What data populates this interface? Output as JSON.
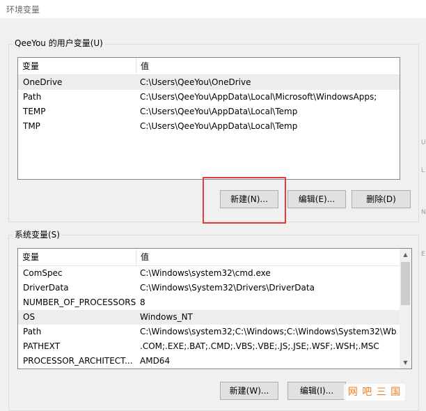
{
  "window": {
    "title": "环境变量"
  },
  "user_vars": {
    "group_label": "QeeYou 的用户变量(U)",
    "columns": [
      "变量",
      "值"
    ],
    "rows": [
      {
        "name": "OneDrive",
        "value": "C:\\Users\\QeeYou\\OneDrive",
        "selected": true
      },
      {
        "name": "Path",
        "value": "C:\\Users\\QeeYou\\AppData\\Local\\Microsoft\\WindowsApps;",
        "selected": false
      },
      {
        "name": "TEMP",
        "value": "C:\\Users\\QeeYou\\AppData\\Local\\Temp",
        "selected": false
      },
      {
        "name": "TMP",
        "value": "C:\\Users\\QeeYou\\AppData\\Local\\Temp",
        "selected": false
      }
    ],
    "buttons": {
      "new": "新建(N)...",
      "edit": "编辑(E)...",
      "delete": "删除(D)"
    }
  },
  "system_vars": {
    "group_label": "系统变量(S)",
    "columns": [
      "变量",
      "值"
    ],
    "rows": [
      {
        "name": "ComSpec",
        "value": "C:\\Windows\\system32\\cmd.exe",
        "selected": false
      },
      {
        "name": "DriverData",
        "value": "C:\\Windows\\System32\\Drivers\\DriverData",
        "selected": false
      },
      {
        "name": "NUMBER_OF_PROCESSORS",
        "value": "8",
        "selected": false
      },
      {
        "name": "OS",
        "value": "Windows_NT",
        "selected": true
      },
      {
        "name": "Path",
        "value": "C:\\Windows\\system32;C:\\Windows;C:\\Windows\\System32\\Wb...",
        "selected": false
      },
      {
        "name": "PATHEXT",
        "value": ".COM;.EXE;.BAT;.CMD;.VBS;.VBE;.JS;.JSE;.WSF;.WSH;.MSC",
        "selected": false
      },
      {
        "name": "PROCESSOR_ARCHITECT...",
        "value": "AMD64",
        "selected": false
      }
    ],
    "buttons": {
      "new": "新建(W)...",
      "edit": "编辑(I)..."
    }
  },
  "watermark": {
    "text": "网 吧 三 国"
  },
  "edge_marks": [
    "U",
    "L",
    "N",
    "E"
  ],
  "highlight_color": "#e23c3c"
}
